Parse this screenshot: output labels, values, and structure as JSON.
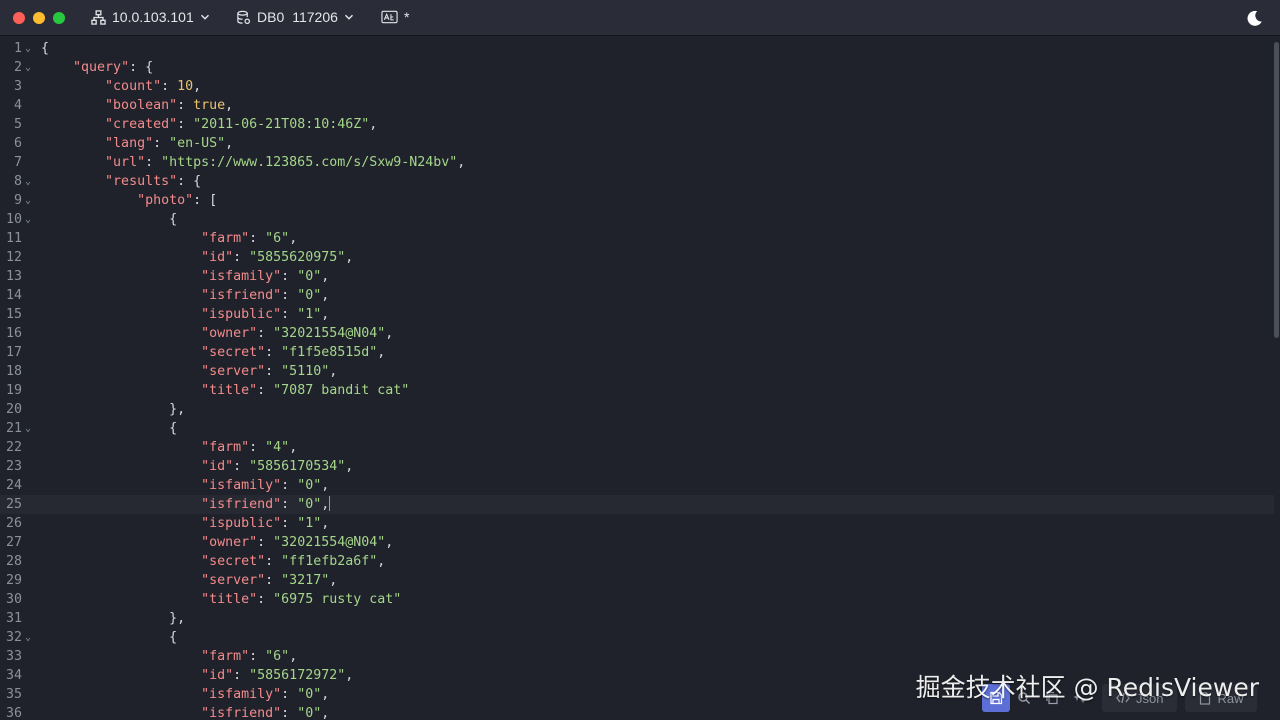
{
  "titlebar": {
    "host": "10.0.103.101",
    "db": "DB0",
    "db_count": "117206",
    "format_mark": "*"
  },
  "icons": {
    "host": "network-tree-icon",
    "db": "database-settings-icon",
    "format": "text-format-icon",
    "theme": "moon-icon"
  },
  "editor": {
    "lines": [
      {
        "n": "1",
        "fold": true,
        "h": "<span class=\"p\">{</span>"
      },
      {
        "n": "2",
        "fold": true,
        "h": "    <span class=\"k\">\"query\"</span><span class=\"p\">: {</span>"
      },
      {
        "n": "3",
        "h": "        <span class=\"k\">\"count\"</span><span class=\"p\">: </span><span class=\"n\">10</span><span class=\"p\">,</span>"
      },
      {
        "n": "4",
        "h": "        <span class=\"k\">\"boolean\"</span><span class=\"p\">: </span><span class=\"b\">true</span><span class=\"p\">,</span>"
      },
      {
        "n": "5",
        "h": "        <span class=\"k\">\"created\"</span><span class=\"p\">: </span><span class=\"s\">\"2011-06-21T08:10:46Z\"</span><span class=\"p\">,</span>"
      },
      {
        "n": "6",
        "h": "        <span class=\"k\">\"lang\"</span><span class=\"p\">: </span><span class=\"s\">\"en-US\"</span><span class=\"p\">,</span>"
      },
      {
        "n": "7",
        "h": "        <span class=\"k\">\"url\"</span><span class=\"p\">: </span><span class=\"s\">\"https://www.123865.com/s/Sxw9-N24bv\"</span><span class=\"p\">,</span>"
      },
      {
        "n": "8",
        "fold": true,
        "h": "        <span class=\"k\">\"results\"</span><span class=\"p\">: {</span>"
      },
      {
        "n": "9",
        "fold": true,
        "h": "            <span class=\"k\">\"photo\"</span><span class=\"p\">: [</span>"
      },
      {
        "n": "10",
        "fold": true,
        "h": "                <span class=\"p\">{</span>"
      },
      {
        "n": "11",
        "h": "                    <span class=\"k\">\"farm\"</span><span class=\"p\">: </span><span class=\"s\">\"6\"</span><span class=\"p\">,</span>"
      },
      {
        "n": "12",
        "h": "                    <span class=\"k\">\"id\"</span><span class=\"p\">: </span><span class=\"s\">\"5855620975\"</span><span class=\"p\">,</span>"
      },
      {
        "n": "13",
        "h": "                    <span class=\"k\">\"isfamily\"</span><span class=\"p\">: </span><span class=\"s\">\"0\"</span><span class=\"p\">,</span>"
      },
      {
        "n": "14",
        "h": "                    <span class=\"k\">\"isfriend\"</span><span class=\"p\">: </span><span class=\"s\">\"0\"</span><span class=\"p\">,</span>"
      },
      {
        "n": "15",
        "h": "                    <span class=\"k\">\"ispublic\"</span><span class=\"p\">: </span><span class=\"s\">\"1\"</span><span class=\"p\">,</span>"
      },
      {
        "n": "16",
        "h": "                    <span class=\"k\">\"owner\"</span><span class=\"p\">: </span><span class=\"s\">\"32021554@N04\"</span><span class=\"p\">,</span>"
      },
      {
        "n": "17",
        "h": "                    <span class=\"k\">\"secret\"</span><span class=\"p\">: </span><span class=\"s\">\"f1f5e8515d\"</span><span class=\"p\">,</span>"
      },
      {
        "n": "18",
        "h": "                    <span class=\"k\">\"server\"</span><span class=\"p\">: </span><span class=\"s\">\"5110\"</span><span class=\"p\">,</span>"
      },
      {
        "n": "19",
        "h": "                    <span class=\"k\">\"title\"</span><span class=\"p\">: </span><span class=\"s\">\"7087 bandit cat\"</span>"
      },
      {
        "n": "20",
        "h": "                <span class=\"p\">},</span>"
      },
      {
        "n": "21",
        "fold": true,
        "h": "                <span class=\"p\">{</span>"
      },
      {
        "n": "22",
        "h": "                    <span class=\"k\">\"farm\"</span><span class=\"p\">: </span><span class=\"s\">\"4\"</span><span class=\"p\">,</span>"
      },
      {
        "n": "23",
        "h": "                    <span class=\"k\">\"id\"</span><span class=\"p\">: </span><span class=\"s\">\"5856170534\"</span><span class=\"p\">,</span>"
      },
      {
        "n": "24",
        "h": "                    <span class=\"k\">\"isfamily\"</span><span class=\"p\">: </span><span class=\"s\">\"0\"</span><span class=\"p\">,</span>"
      },
      {
        "n": "25",
        "active": true,
        "h": "                    <span class=\"k\">\"isfriend\"</span><span class=\"p\">: </span><span class=\"s\">\"0\"</span><span class=\"p\">,</span><span class=\"cursor\"></span>"
      },
      {
        "n": "26",
        "h": "                    <span class=\"k\">\"ispublic\"</span><span class=\"p\">: </span><span class=\"s\">\"1\"</span><span class=\"p\">,</span>"
      },
      {
        "n": "27",
        "h": "                    <span class=\"k\">\"owner\"</span><span class=\"p\">: </span><span class=\"s\">\"32021554@N04\"</span><span class=\"p\">,</span>"
      },
      {
        "n": "28",
        "h": "                    <span class=\"k\">\"secret\"</span><span class=\"p\">: </span><span class=\"s\">\"ff1efb2a6f\"</span><span class=\"p\">,</span>"
      },
      {
        "n": "29",
        "h": "                    <span class=\"k\">\"server\"</span><span class=\"p\">: </span><span class=\"s\">\"3217\"</span><span class=\"p\">,</span>"
      },
      {
        "n": "30",
        "h": "                    <span class=\"k\">\"title\"</span><span class=\"p\">: </span><span class=\"s\">\"6975 rusty cat\"</span>"
      },
      {
        "n": "31",
        "h": "                <span class=\"p\">},</span>"
      },
      {
        "n": "32",
        "fold": true,
        "h": "                <span class=\"p\">{</span>"
      },
      {
        "n": "33",
        "h": "                    <span class=\"k\">\"farm\"</span><span class=\"p\">: </span><span class=\"s\">\"6\"</span><span class=\"p\">,</span>"
      },
      {
        "n": "34",
        "h": "                    <span class=\"k\">\"id\"</span><span class=\"p\">: </span><span class=\"s\">\"5856172972\"</span><span class=\"p\">,</span>"
      },
      {
        "n": "35",
        "h": "                    <span class=\"k\">\"isfamily\"</span><span class=\"p\">: </span><span class=\"s\">\"0\"</span><span class=\"p\">,</span>"
      },
      {
        "n": "36",
        "h": "                    <span class=\"k\">\"isfriend\"</span><span class=\"p\">: </span><span class=\"s\">\"0\"</span><span class=\"p\">,</span>"
      }
    ]
  },
  "bottom_toolbar": {
    "json_label": "Json",
    "raw_label": "Raw"
  },
  "watermark": "掘金技术社区 @ RedisViewer"
}
